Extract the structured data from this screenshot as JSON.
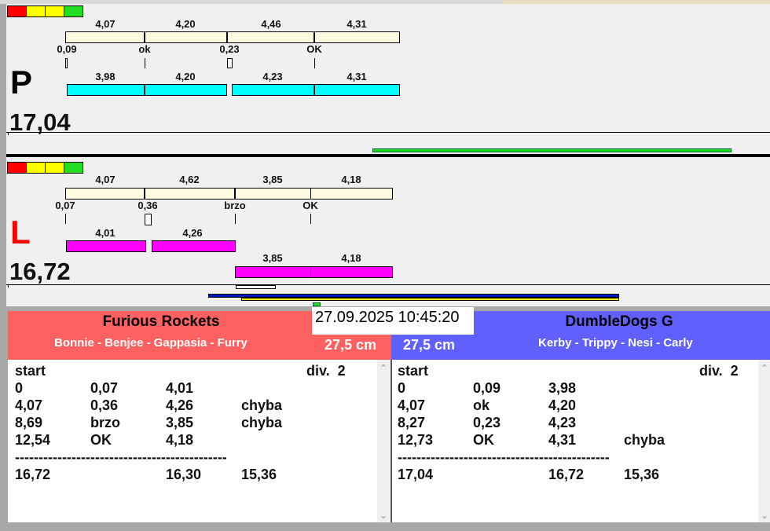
{
  "indicator_colors": [
    "#ff0000",
    "#ffff00",
    "#ffff00",
    "#22dd22"
  ],
  "top_lane": {
    "letter": "P",
    "letter_color": "#0000ee",
    "total": "17,04",
    "ref_labels": [
      "4,07",
      "4,20",
      "4,46",
      "4,31"
    ],
    "marks": [
      "0,09",
      "ok",
      "0,23",
      "OK"
    ],
    "run_labels": [
      "3,98",
      "4,20",
      "4,23",
      "4,31"
    ],
    "run_color": "#00ffff"
  },
  "bottom_lane": {
    "letter": "L",
    "letter_color": "#ff0000",
    "total": "16,72",
    "ref_labels": [
      "4,07",
      "4,62",
      "3,85",
      "4,18"
    ],
    "marks": [
      "0,07",
      "0,36",
      "brzo",
      "OK"
    ],
    "run_labels": [
      "4,01",
      "4,26"
    ],
    "run2_labels": [
      "3,85",
      "4,18"
    ],
    "run_color": "#ff00ff"
  },
  "datetime": "27.09.2025 10:45:20",
  "left_team": {
    "name": "Furious Rockets",
    "dogs": "Bonnie - Benjee - Gappasia - Furry",
    "height": "27,5 cm",
    "color": "#ff6060",
    "header": [
      "start",
      "div.  2"
    ],
    "rows": [
      [
        "0",
        "0,07",
        "4,01",
        ""
      ],
      [
        "4,07",
        "0,36",
        "4,26",
        "chyba"
      ],
      [
        "8,69",
        "brzo",
        "3,85",
        "chyba"
      ],
      [
        "12,54",
        "OK",
        "4,18",
        ""
      ]
    ],
    "separator": "---------------------------------------------",
    "totals": [
      "16,72",
      "",
      "16,30",
      "15,36"
    ]
  },
  "right_team": {
    "name": "DumbleDogs G",
    "dogs": "Kerby - Trippy - Nesi - Carly",
    "height": "27,5 cm",
    "color": "#6060ff",
    "header": [
      "start",
      "div.  2"
    ],
    "rows": [
      [
        "0",
        "0,09",
        "3,98",
        ""
      ],
      [
        "4,07",
        "ok",
        "4,20",
        ""
      ],
      [
        "8,27",
        "0,23",
        "4,23",
        ""
      ],
      [
        "12,73",
        "OK",
        "4,31",
        "chyba"
      ]
    ],
    "separator": "---------------------------------------------",
    "totals": [
      "17,04",
      "",
      "16,72",
      "15,36"
    ]
  }
}
